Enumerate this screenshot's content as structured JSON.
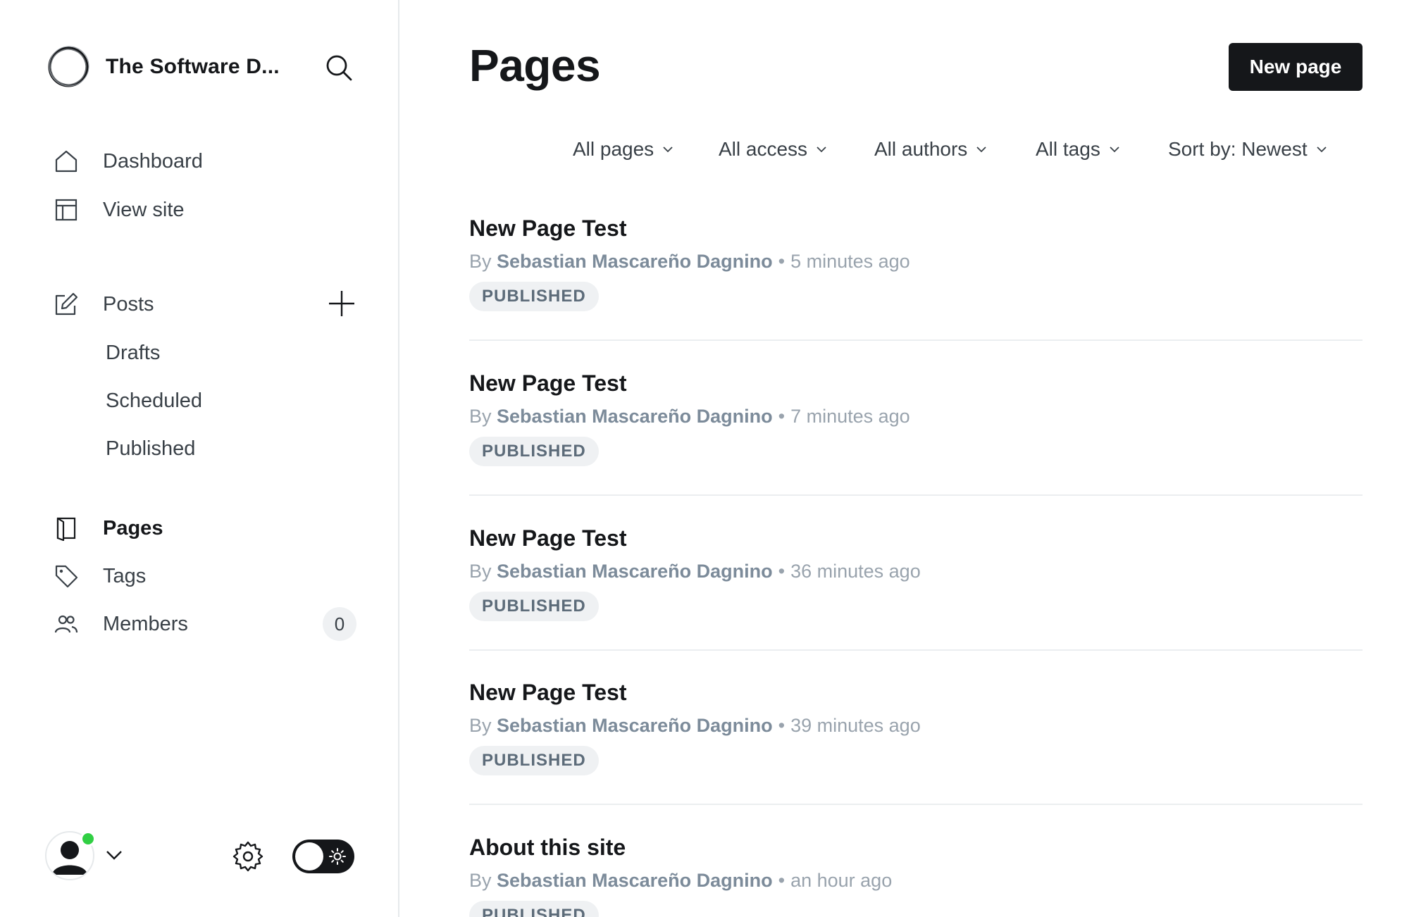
{
  "sidebar": {
    "site_title": "The Software D...",
    "nav": {
      "dashboard": "Dashboard",
      "view_site": "View site",
      "posts": "Posts",
      "drafts": "Drafts",
      "scheduled": "Scheduled",
      "published": "Published",
      "pages": "Pages",
      "tags": "Tags",
      "members": "Members",
      "members_count": "0"
    },
    "icons": [
      "site-logo-icon",
      "search-icon",
      "home-icon",
      "layout-icon",
      "edit-icon",
      "plus-icon",
      "page-icon",
      "tag-icon",
      "members-icon",
      "avatar-icon",
      "chevron-down-icon",
      "gear-icon",
      "sun-icon"
    ],
    "status_color": "#30cf43"
  },
  "main": {
    "title": "Pages",
    "new_button": "New page",
    "filters": {
      "type": "All pages",
      "access": "All access",
      "authors": "All authors",
      "tags": "All tags",
      "sort": "Sort by: Newest"
    },
    "pages": [
      {
        "title": "New Page Test",
        "by": "By",
        "author": "Sebastian Mascareño Dagnino",
        "sep": "•",
        "time": "5 minutes ago",
        "status": "PUBLISHED"
      },
      {
        "title": "New Page Test",
        "by": "By",
        "author": "Sebastian Mascareño Dagnino",
        "sep": "•",
        "time": "7 minutes ago",
        "status": "PUBLISHED"
      },
      {
        "title": "New Page Test",
        "by": "By",
        "author": "Sebastian Mascareño Dagnino",
        "sep": "•",
        "time": "36 minutes ago",
        "status": "PUBLISHED"
      },
      {
        "title": "New Page Test",
        "by": "By",
        "author": "Sebastian Mascareño Dagnino",
        "sep": "•",
        "time": "39 minutes ago",
        "status": "PUBLISHED"
      },
      {
        "title": "About this site",
        "by": "By",
        "author": "Sebastian Mascareño Dagnino",
        "sep": "•",
        "time": "an hour ago",
        "status": "PUBLISHED"
      }
    ]
  },
  "colors": {
    "primary_dark": "#15171a",
    "text_muted": "#99a3ad",
    "badge_bg": "#eff1f3"
  }
}
